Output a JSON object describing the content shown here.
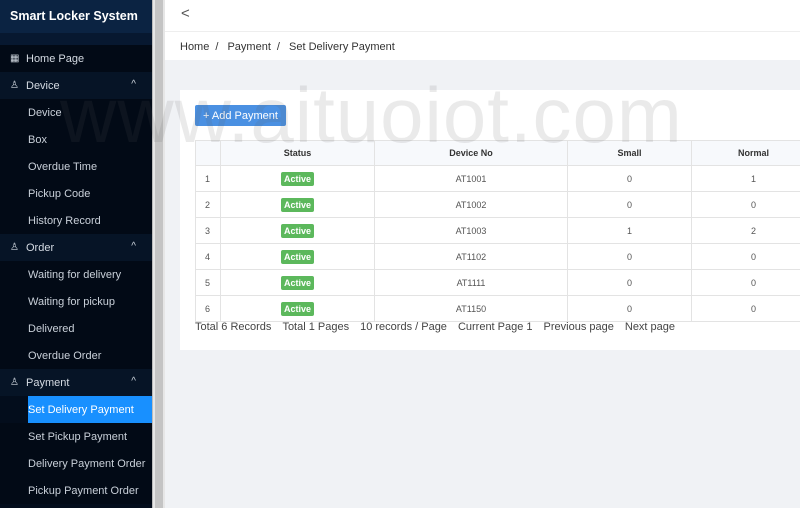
{
  "app_title": "Smart Locker System",
  "watermark": "www.aituoiot.com",
  "sidebar": {
    "home": "Home Page",
    "groups": [
      {
        "label": "Device",
        "items": [
          "Device",
          "Box",
          "Overdue Time",
          "Pickup Code",
          "History Record"
        ]
      },
      {
        "label": "Order",
        "items": [
          "Waiting for delivery",
          "Waiting for pickup",
          "Delivered",
          "Overdue Order"
        ]
      },
      {
        "label": "Payment",
        "items": [
          "Set Delivery Payment",
          "Set Pickup Payment",
          "Delivery Payment Order",
          "Pickup Payment Order"
        ]
      }
    ],
    "selected": "Set Delivery Payment"
  },
  "header": {
    "back": "<"
  },
  "breadcrumb": [
    "Home",
    "Payment",
    "Set Delivery Payment"
  ],
  "breadcrumb_sep": "/",
  "add_button": "+ Add Payment",
  "table": {
    "columns": [
      "",
      "Status",
      "Device No",
      "Small",
      "Normal"
    ],
    "rows": [
      {
        "idx": "1",
        "status": "Active",
        "device": "AT1001",
        "small": "0",
        "normal": "1"
      },
      {
        "idx": "2",
        "status": "Active",
        "device": "AT1002",
        "small": "0",
        "normal": "0"
      },
      {
        "idx": "3",
        "status": "Active",
        "device": "AT1003",
        "small": "1",
        "normal": "2"
      },
      {
        "idx": "4",
        "status": "Active",
        "device": "AT1102",
        "small": "0",
        "normal": "0"
      },
      {
        "idx": "5",
        "status": "Active",
        "device": "AT1111",
        "small": "0",
        "normal": "0"
      },
      {
        "idx": "6",
        "status": "Active",
        "device": "AT1150",
        "small": "0",
        "normal": "0"
      }
    ]
  },
  "pager": {
    "total_records": "Total 6 Records",
    "total_pages": "Total 1 Pages",
    "per_page": "10 records / Page",
    "current": "Current Page 1",
    "prev": "Previous page",
    "next": "Next page"
  },
  "colors": {
    "accent": "#1890ff",
    "active": "#5cb85c",
    "sidebar": "#030d1c"
  }
}
